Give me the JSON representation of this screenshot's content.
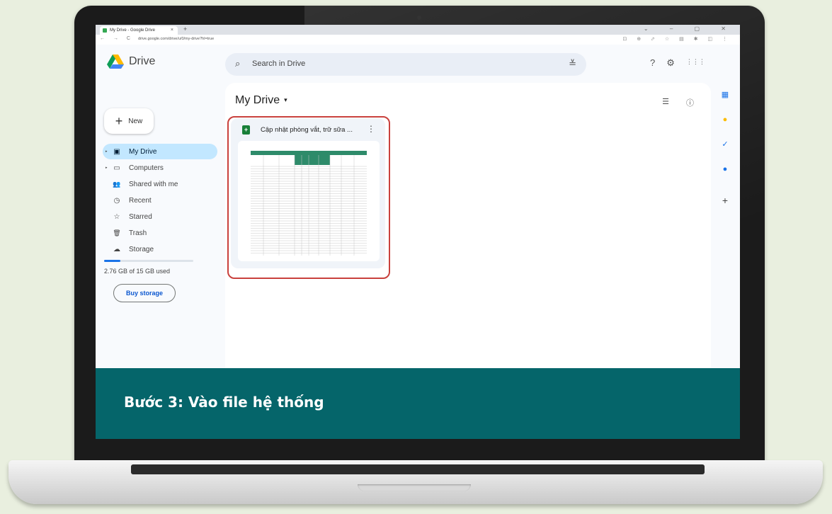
{
  "browser": {
    "tab_title": "My Drive - Google Drive",
    "tab_close": "×",
    "new_tab": "+",
    "window_controls": "⌄ – ▢ ✕",
    "nav": "← → C",
    "url": "drive.google.com/drive/u/0/my-drive?hl=true",
    "extensions": "⊡ ⊕ ⬀ ☆ ▤ ✱ ◫ ⋮"
  },
  "app": {
    "name": "Drive",
    "search_placeholder": "Search in Drive",
    "search_icon": "⌕",
    "tune_icon": "≚",
    "help_icon": "?",
    "settings_icon": "⚙",
    "apps_icon": "⋮⋮⋮"
  },
  "new_button": {
    "plus": "+",
    "label": "New"
  },
  "sidebar": {
    "items": [
      {
        "icon": "▣",
        "label": "My Drive",
        "active": true,
        "expandable": true
      },
      {
        "icon": "▭",
        "label": "Computers",
        "active": false,
        "expandable": true
      },
      {
        "icon": "👥",
        "label": "Shared with me",
        "active": false,
        "expandable": false
      },
      {
        "icon": "◷",
        "label": "Recent",
        "active": false,
        "expandable": false
      },
      {
        "icon": "☆",
        "label": "Starred",
        "active": false,
        "expandable": false
      },
      {
        "icon": "🗑",
        "label": "Trash",
        "active": false,
        "expandable": false
      },
      {
        "icon": "☁",
        "label": "Storage",
        "active": false,
        "expandable": false
      }
    ],
    "arrow": "▸",
    "storage_used_fraction": 0.184,
    "storage_text": "2.76 GB of 15 GB used",
    "buy_storage": "Buy storage"
  },
  "main": {
    "title": "My Drive",
    "title_caret": "▾",
    "list_view_icon": "☰",
    "info_icon": "ⓘ",
    "file": {
      "icon_letter": "+",
      "name": "Cập nhật phòng vắt, trữ sữa ...",
      "menu": "⋮"
    }
  },
  "right_rail": {
    "calendar_icon": "▦",
    "keep_icon": "●",
    "tasks_icon": "✓",
    "contacts_icon": "●",
    "add_icon": "+"
  },
  "caption": "Bước 3: Vào file hệ thống",
  "colors": {
    "caption_band": "#05656a",
    "highlight": "#c9413d",
    "active_nav": "#c2e7ff",
    "sheets_green": "#188038"
  }
}
